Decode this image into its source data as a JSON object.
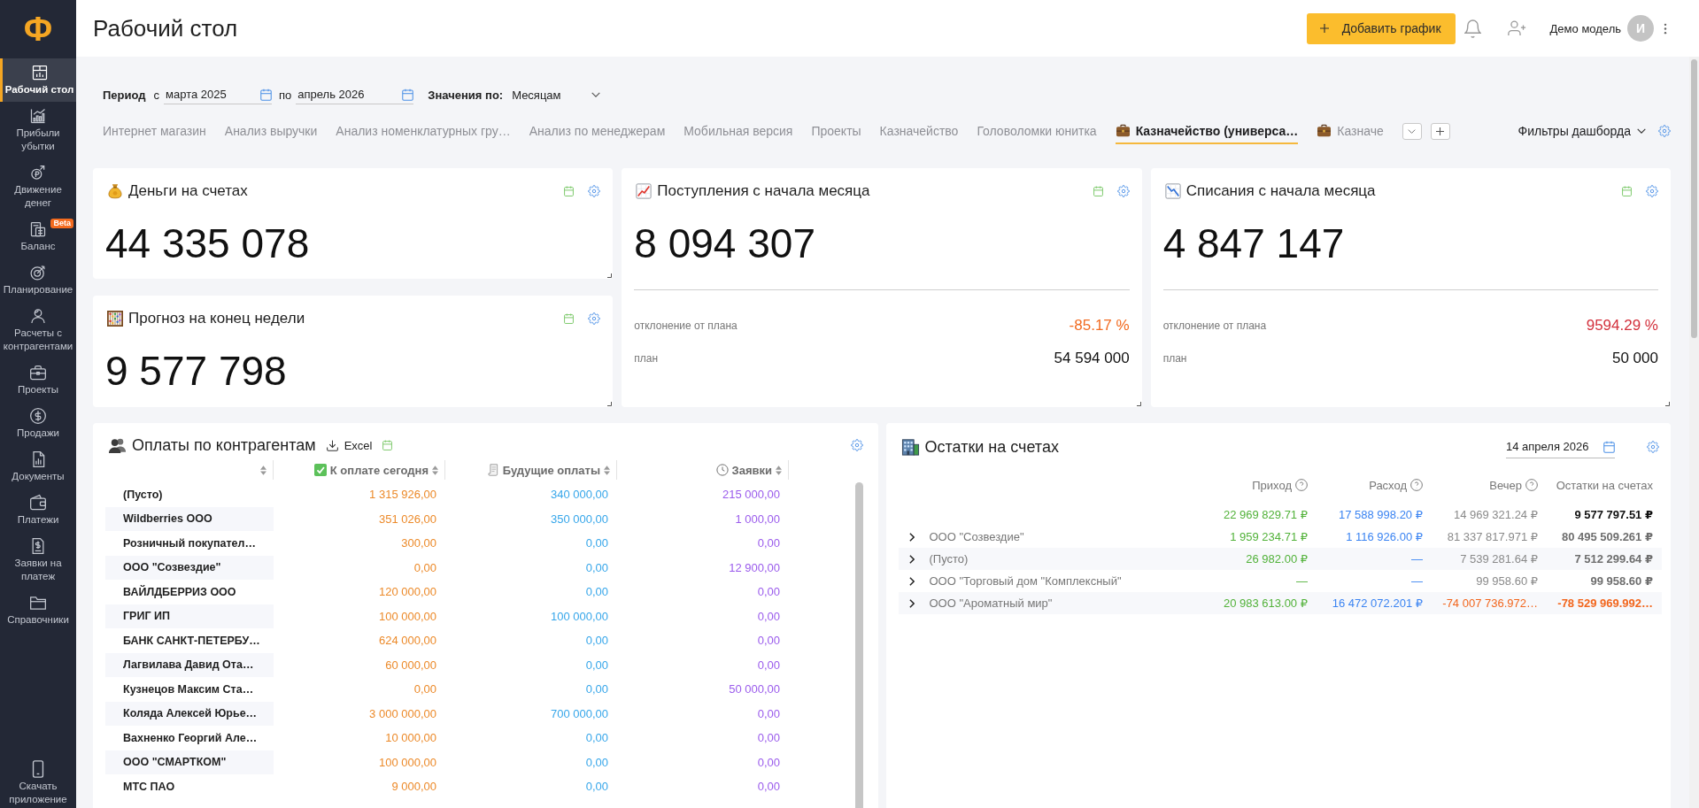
{
  "sidebar": {
    "logo": "Ф",
    "items": [
      {
        "label": "Рабочий стол",
        "selected": true
      },
      {
        "label": "Прибыли убытки",
        "selected": false
      },
      {
        "label": "Движение денег",
        "selected": false
      },
      {
        "label": "Баланс",
        "selected": false,
        "badge": "Beta"
      },
      {
        "label": "Планирование",
        "selected": false
      },
      {
        "label": "Расчеты с контрагентами",
        "selected": false
      },
      {
        "label": "Проекты",
        "selected": false
      },
      {
        "label": "Продажи",
        "selected": false
      },
      {
        "label": "Документы",
        "selected": false
      },
      {
        "label": "Платежи",
        "selected": false
      },
      {
        "label": "Заявки на платеж",
        "selected": false
      },
      {
        "label": "Справочники",
        "selected": false
      }
    ],
    "download": "Скачать приложение"
  },
  "header": {
    "title": "Рабочий стол",
    "add_button": "Добавить график",
    "user": {
      "name": "Демо модель",
      "initial": "И"
    }
  },
  "filters": {
    "period_label": "Период",
    "from_label": "с",
    "from": "марта 2025",
    "to_label": "по",
    "to": "апрель 2026",
    "values_label": "Значения по:",
    "values": "Месяцам"
  },
  "tabs": [
    {
      "label": "Интернет магазин",
      "selected": false,
      "icon": false
    },
    {
      "label": "Анализ выручки",
      "selected": false,
      "icon": false
    },
    {
      "label": "Анализ номенклатурных гру…",
      "selected": false,
      "icon": false
    },
    {
      "label": "Анализ по менеджерам",
      "selected": false,
      "icon": false
    },
    {
      "label": "Мобильная версия",
      "selected": false,
      "icon": false
    },
    {
      "label": "Проекты",
      "selected": false,
      "icon": false
    },
    {
      "label": "Казначейство",
      "selected": false,
      "icon": false
    },
    {
      "label": "Головоломки юнитка",
      "selected": false,
      "icon": false
    },
    {
      "label": "Казначейство (универса…",
      "selected": true,
      "icon": true
    },
    {
      "label": "Казначе",
      "selected": false,
      "icon": true
    }
  ],
  "dashboard_filters": "Фильтры дашборда",
  "cards": [
    {
      "kind": "simple",
      "title": "Деньги на счетах",
      "value": "44 335 078"
    },
    {
      "kind": "plan",
      "title": "Поступления с начала месяца",
      "value": "8 094 307",
      "deviation": {
        "label": "отклонение от плана",
        "value": "-85.17 %",
        "color": "#f26b21"
      },
      "plan": {
        "label": "план",
        "value": "54 594 000"
      }
    },
    {
      "kind": "plan",
      "title": "Списания с начала месяца",
      "value": "4 847 147",
      "deviation": {
        "label": "отклонение от плана",
        "value": "9594.29 %",
        "color": "#d3303c"
      },
      "plan": {
        "label": "план",
        "value": "50 000"
      }
    },
    {
      "kind": "simple",
      "title": "Прогноз на конец недели",
      "value": "9 577 798"
    }
  ],
  "payments": {
    "title": "Оплаты по контрагентам",
    "excel": "Excel",
    "columns": [
      {
        "label": "К оплате сегодня",
        "color": "#ec8a2a"
      },
      {
        "label": "Будущие оплаты",
        "color": "#36a6ea"
      },
      {
        "label": "Заявки",
        "color": "#9b5cec"
      }
    ],
    "rows": [
      {
        "name": "(Пусто)",
        "values": [
          "1 315 926,00",
          "340 000,00",
          "215 000,00"
        ]
      },
      {
        "name": "Wildberries ООО",
        "values": [
          "351 026,00",
          "350 000,00",
          "1 000,00"
        ]
      },
      {
        "name": "Розничный покупател…",
        "values": [
          "300,00",
          "0,00",
          "0,00"
        ]
      },
      {
        "name": "ООО \"Созвездие\"",
        "values": [
          "0,00",
          "0,00",
          "12 900,00"
        ]
      },
      {
        "name": "ВАЙЛДБЕРРИЗ ООО",
        "values": [
          "120 000,00",
          "0,00",
          "0,00"
        ]
      },
      {
        "name": "ГРИГ ИП",
        "values": [
          "100 000,00",
          "100 000,00",
          "0,00"
        ]
      },
      {
        "name": "БАНК САНКТ-ПЕТЕРБУ…",
        "values": [
          "624 000,00",
          "0,00",
          "0,00"
        ]
      },
      {
        "name": "Лагвилава Давид Ота…",
        "values": [
          "60 000,00",
          "0,00",
          "0,00"
        ]
      },
      {
        "name": "Кузнецов Максим Ста…",
        "values": [
          "0,00",
          "0,00",
          "50 000,00"
        ]
      },
      {
        "name": "Коляда Алексей Юрье…",
        "values": [
          "3 000 000,00",
          "700 000,00",
          "0,00"
        ]
      },
      {
        "name": "Вахненко Георгий Але…",
        "values": [
          "10 000,00",
          "0,00",
          "0,00"
        ]
      },
      {
        "name": "ООО \"СМАРТКОМ\"",
        "values": [
          "100 000,00",
          "0,00",
          "0,00"
        ]
      },
      {
        "name": "МТС ПАО",
        "values": [
          "9 000,00",
          "0,00",
          "0,00"
        ]
      }
    ]
  },
  "balances": {
    "title": "Остатки на счетах",
    "date": "14 апреля 2026",
    "columns": [
      {
        "label": "Приход",
        "help": true,
        "color": "#52b23a"
      },
      {
        "label": "Расход",
        "help": true,
        "color": "#3b84f2"
      },
      {
        "label": "Вечер",
        "help": true,
        "color": "#8a8a8a"
      },
      {
        "label": "Остатки на счетах",
        "help": false,
        "color": "#6e6e6e"
      }
    ],
    "totals": [
      "22 969 829.71 ₽",
      "17 588 998.20 ₽",
      "14 969 321.24 ₽",
      "9 577 797.51 ₽"
    ],
    "rows": [
      {
        "name": "ООО \"Созвездие\"",
        "expanded": false,
        "negative": false,
        "values": [
          "1 959 234.71 ₽",
          "1 116 926.00 ₽",
          "81 337 817.971 ₽",
          "80 495 509.261 ₽"
        ]
      },
      {
        "name": "(Пусто)",
        "expanded": false,
        "negative": false,
        "values": [
          "26 982.00 ₽",
          "—",
          "7 539 281.64 ₽",
          "7 512 299.64 ₽"
        ]
      },
      {
        "name": "ООО \"Торговый дом \"Комплексный\"",
        "expanded": false,
        "negative": false,
        "values": [
          "—",
          "—",
          "99 958.60 ₽",
          "99 958.60 ₽"
        ]
      },
      {
        "name": "ООО \"Ароматный мир\"",
        "expanded": false,
        "negative": true,
        "values": [
          "20 983 613.00 ₽",
          "16 472 072.201 ₽",
          "-74 007 736.972…",
          "-78 529 969.992…"
        ]
      }
    ]
  }
}
